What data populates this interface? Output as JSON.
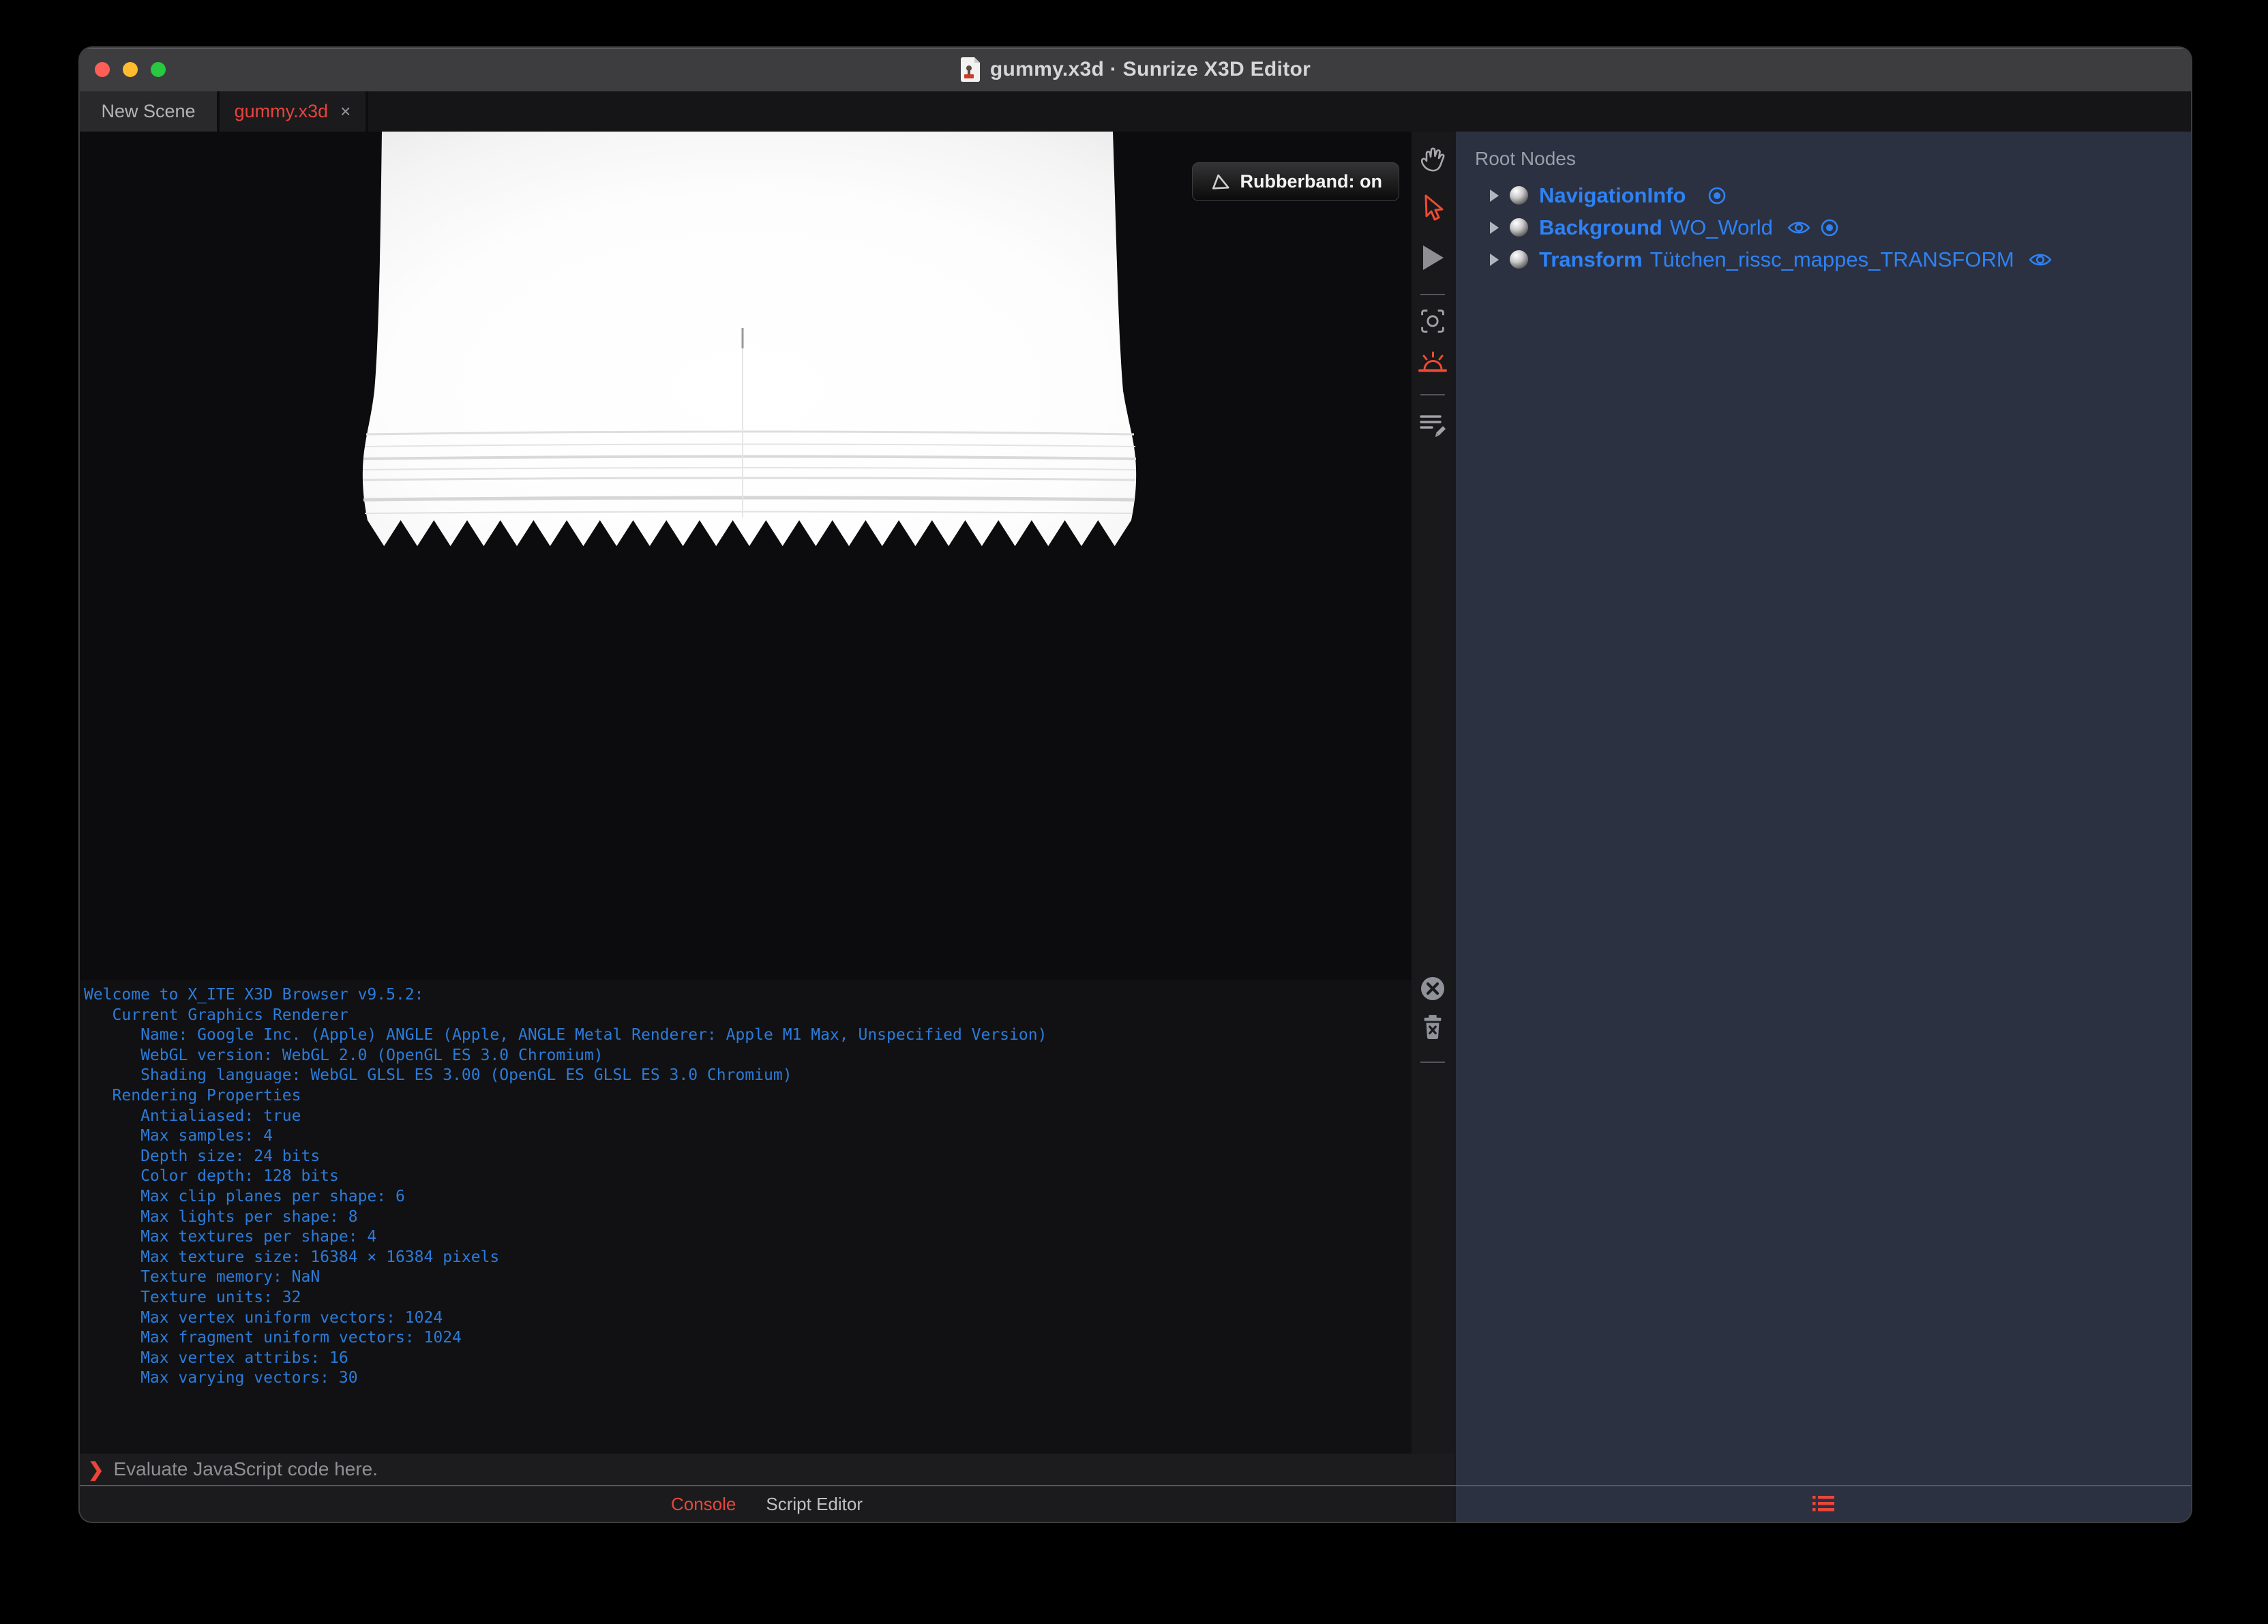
{
  "window": {
    "title": "gummy.x3d · Sunrize X3D Editor"
  },
  "tabs": [
    {
      "label": "New Scene",
      "active": false
    },
    {
      "label": "gummy.x3d",
      "active": true,
      "close_label": "×"
    }
  ],
  "viewport": {
    "rubberband_label": "Rubberband: on"
  },
  "outline": {
    "header": "Root Nodes",
    "nodes": [
      {
        "type": "NavigationInfo",
        "name": "",
        "icons": [
          "bind"
        ]
      },
      {
        "type": "Background",
        "name": "WO_World",
        "icons": [
          "eye",
          "bind"
        ]
      },
      {
        "type": "Transform",
        "name": "Tütchen_rissc_mappes_TRANSFORM",
        "icons": [
          "eye"
        ]
      }
    ]
  },
  "console": {
    "text": "Welcome to X_ITE X3D Browser v9.5.2:\n   Current Graphics Renderer\n      Name: Google Inc. (Apple) ANGLE (Apple, ANGLE Metal Renderer: Apple M1 Max, Unspecified Version)\n      WebGL version: WebGL 2.0 (OpenGL ES 3.0 Chromium)\n      Shading language: WebGL GLSL ES 3.00 (OpenGL ES GLSL ES 3.0 Chromium)\n   Rendering Properties\n      Antialiased: true\n      Max samples: 4\n      Depth size: 24 bits\n      Color depth: 128 bits\n      Max clip planes per shape: 6\n      Max lights per shape: 8\n      Max textures per shape: 4\n      Max texture size: 16384 × 16384 pixels\n      Texture memory: NaN\n      Texture units: 32\n      Max vertex uniform vectors: 1024\n      Max fragment uniform vectors: 1024\n      Max vertex attribs: 16\n      Max varying vectors: 30",
    "prompt": "❯",
    "placeholder": "Evaluate JavaScript code here.",
    "tabs": [
      {
        "label": "Console",
        "active": true
      },
      {
        "label": "Script Editor",
        "active": false
      }
    ]
  },
  "colors": {
    "accent_red": "#ef4636",
    "node_blue": "#2e82f6",
    "console_blue": "#2c7bd9",
    "panel_bg": "#2b3140",
    "titlebar_bg": "#3d3d3f",
    "traffic_red": "#ff5f57",
    "traffic_yellow": "#febc2e",
    "traffic_green": "#28c840"
  },
  "icons": {
    "titlebar": "x3d-file-icon",
    "strip": [
      "hand-pan-icon",
      "cursor-arrow-icon",
      "play-icon",
      "center-view-icon",
      "sunrise-icon",
      "script-edit-icon",
      "clear-circle-icon",
      "trash-icon"
    ],
    "footer": "outline-list-icon"
  }
}
